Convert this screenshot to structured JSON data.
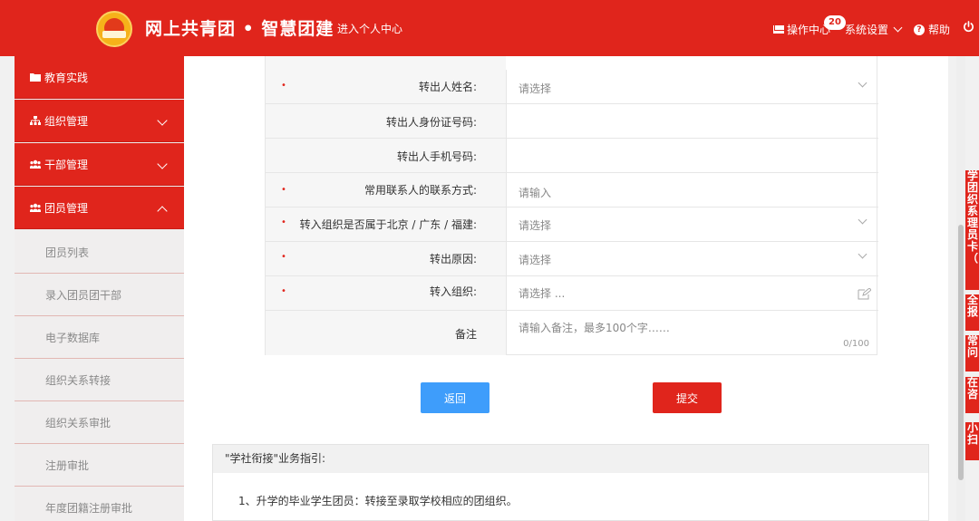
{
  "header": {
    "title": "网上共青团 • 智慧团建",
    "personal_center": "进入个人中心",
    "ops_center": "操作中心",
    "ops_badge": "20",
    "settings": "系统设置",
    "help": "帮助"
  },
  "sidebar": {
    "menus": [
      {
        "label": "教育实践"
      },
      {
        "label": "组织管理"
      },
      {
        "label": "干部管理"
      },
      {
        "label": "团员管理"
      }
    ],
    "sub_items": [
      {
        "label": "团员列表"
      },
      {
        "label": "录入团员团干部"
      },
      {
        "label": "电子数据库"
      },
      {
        "label": "组织关系转接"
      },
      {
        "label": "组织关系审批"
      },
      {
        "label": "注册审批"
      },
      {
        "label": "年度团籍注册审批"
      }
    ]
  },
  "form": {
    "rows": [
      {
        "label": "转出人姓名:",
        "value": "请选择",
        "required": "•"
      },
      {
        "label": "转出人身份证号码:",
        "value": "",
        "required": ""
      },
      {
        "label": "转出人手机号码:",
        "value": "",
        "required": ""
      },
      {
        "label": "常用联系人的联系方式:",
        "value": "请输入",
        "required": "•"
      },
      {
        "label": "转入组织是否属于北京 / 广东 / 福建:",
        "value": "请选择",
        "required": "•"
      },
      {
        "label": "转出原因:",
        "value": "请选择",
        "required": "•"
      },
      {
        "label": "转入组织:",
        "value": "请选择 ...",
        "required": "•"
      },
      {
        "label": "备注",
        "value": "请输入备注，最多100个字……",
        "required": ""
      }
    ],
    "remark_counter": "0/100"
  },
  "buttons": {
    "back": "返回",
    "submit": "提交"
  },
  "guide": {
    "title": "\"学社衔接\"业务指引:",
    "line1": "1、升学的毕业学生团员：转接至录取学校相应的团组织。"
  },
  "side_tabs": [
    "学团织系理员卡（",
    "全报",
    "常问",
    "在咨",
    "小扫"
  ],
  "colors": {
    "brand_red": "#e0251c",
    "button_blue": "#3e9dfb"
  }
}
